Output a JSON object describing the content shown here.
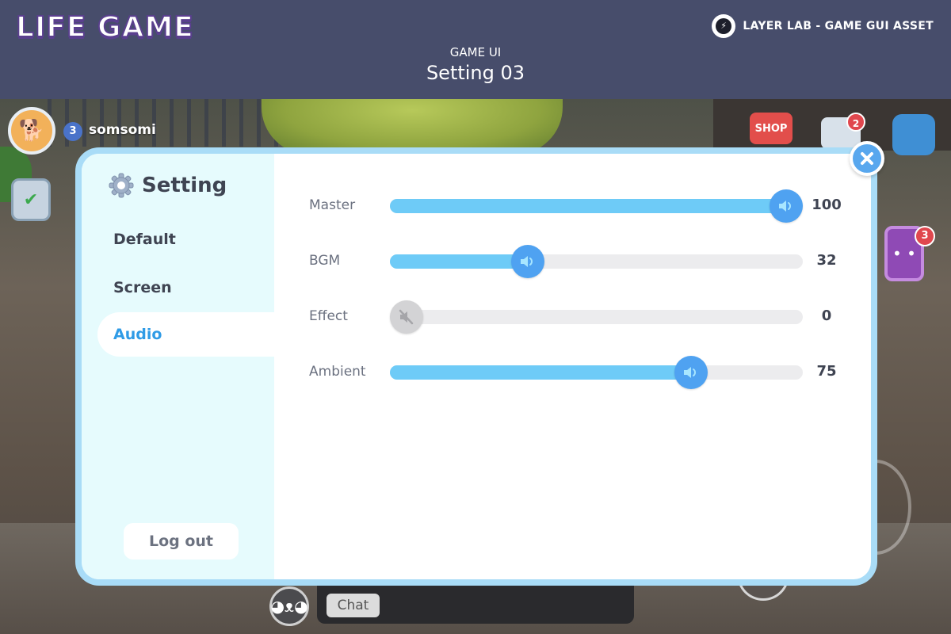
{
  "header": {
    "logo": "LIFE GAME",
    "brand": "LAYER LAB - GAME GUI ASSET",
    "subtitle": "GAME UI",
    "title": "Setting 03"
  },
  "hud": {
    "player_level": "3",
    "player_name": "somsomi",
    "shop_label": "SHOP",
    "mail_badge": "2",
    "phone_badge": "3",
    "chat_label": "Chat"
  },
  "settings": {
    "title": "Setting",
    "menu": [
      {
        "label": "Default",
        "active": false
      },
      {
        "label": "Screen",
        "active": false
      },
      {
        "label": "Audio",
        "active": true
      }
    ],
    "logout_label": "Log out",
    "sliders": [
      {
        "label": "Master",
        "value": 100,
        "display": "100",
        "muted": false
      },
      {
        "label": "BGM",
        "value": 32,
        "display": "32",
        "muted": false
      },
      {
        "label": "Effect",
        "value": 0,
        "display": "0",
        "muted": true
      },
      {
        "label": "Ambient",
        "value": 75,
        "display": "75",
        "muted": false
      }
    ]
  },
  "colors": {
    "accent": "#4fa2f1",
    "fill": "#6ecbf7",
    "header_bg": "#474d6b",
    "dialog_border": "#a9dcf7",
    "sidebar_bg": "#e6fbfd"
  },
  "icons": {
    "close": "close-icon",
    "gear": "gear-icon",
    "volume": "speaker-icon",
    "muted": "speaker-muted-icon"
  }
}
